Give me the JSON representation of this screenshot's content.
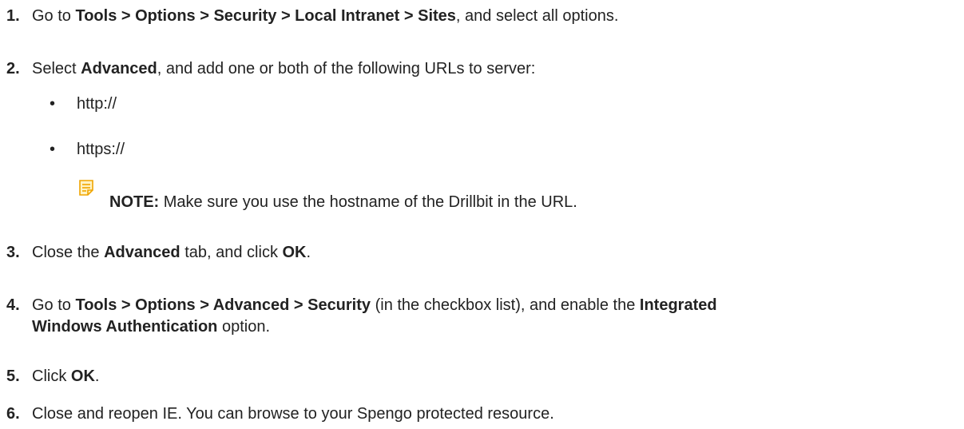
{
  "steps": [
    {
      "num": "1.",
      "t0": "Go to ",
      "b0": "Tools > Options > Security > Local Intranet > Sites",
      "t1": ", and select all options."
    },
    {
      "num": "2.",
      "t0": "Select ",
      "b0": "Advanced",
      "t1": ", and add one or both of the following URLs to server:"
    },
    {
      "num": "3.",
      "t0": "Close the ",
      "b0": "Advanced",
      "t1": " tab, and click ",
      "b1": "OK",
      "t2": "."
    },
    {
      "num": "4.",
      "t0": "Go to ",
      "b0": "Tools > Options > Advanced > Security",
      "t1": " (in the checkbox list), and enable the ",
      "b1": "Integrated",
      "b2": "Windows Authentication",
      "t2": " option."
    },
    {
      "num": "5.",
      "t0": "Click ",
      "b0": "OK",
      "t1": "."
    },
    {
      "num": "6.",
      "t0": "Close and reopen IE. You can browse to your Spengo protected resource."
    }
  ],
  "bullets": [
    "http://",
    "https://"
  ],
  "bullet_char": "•",
  "note": {
    "label": "NOTE:",
    "text": " Make sure you use the hostname of the Drillbit in the URL.",
    "icon": "note-icon",
    "icon_color": "#f0a500"
  }
}
